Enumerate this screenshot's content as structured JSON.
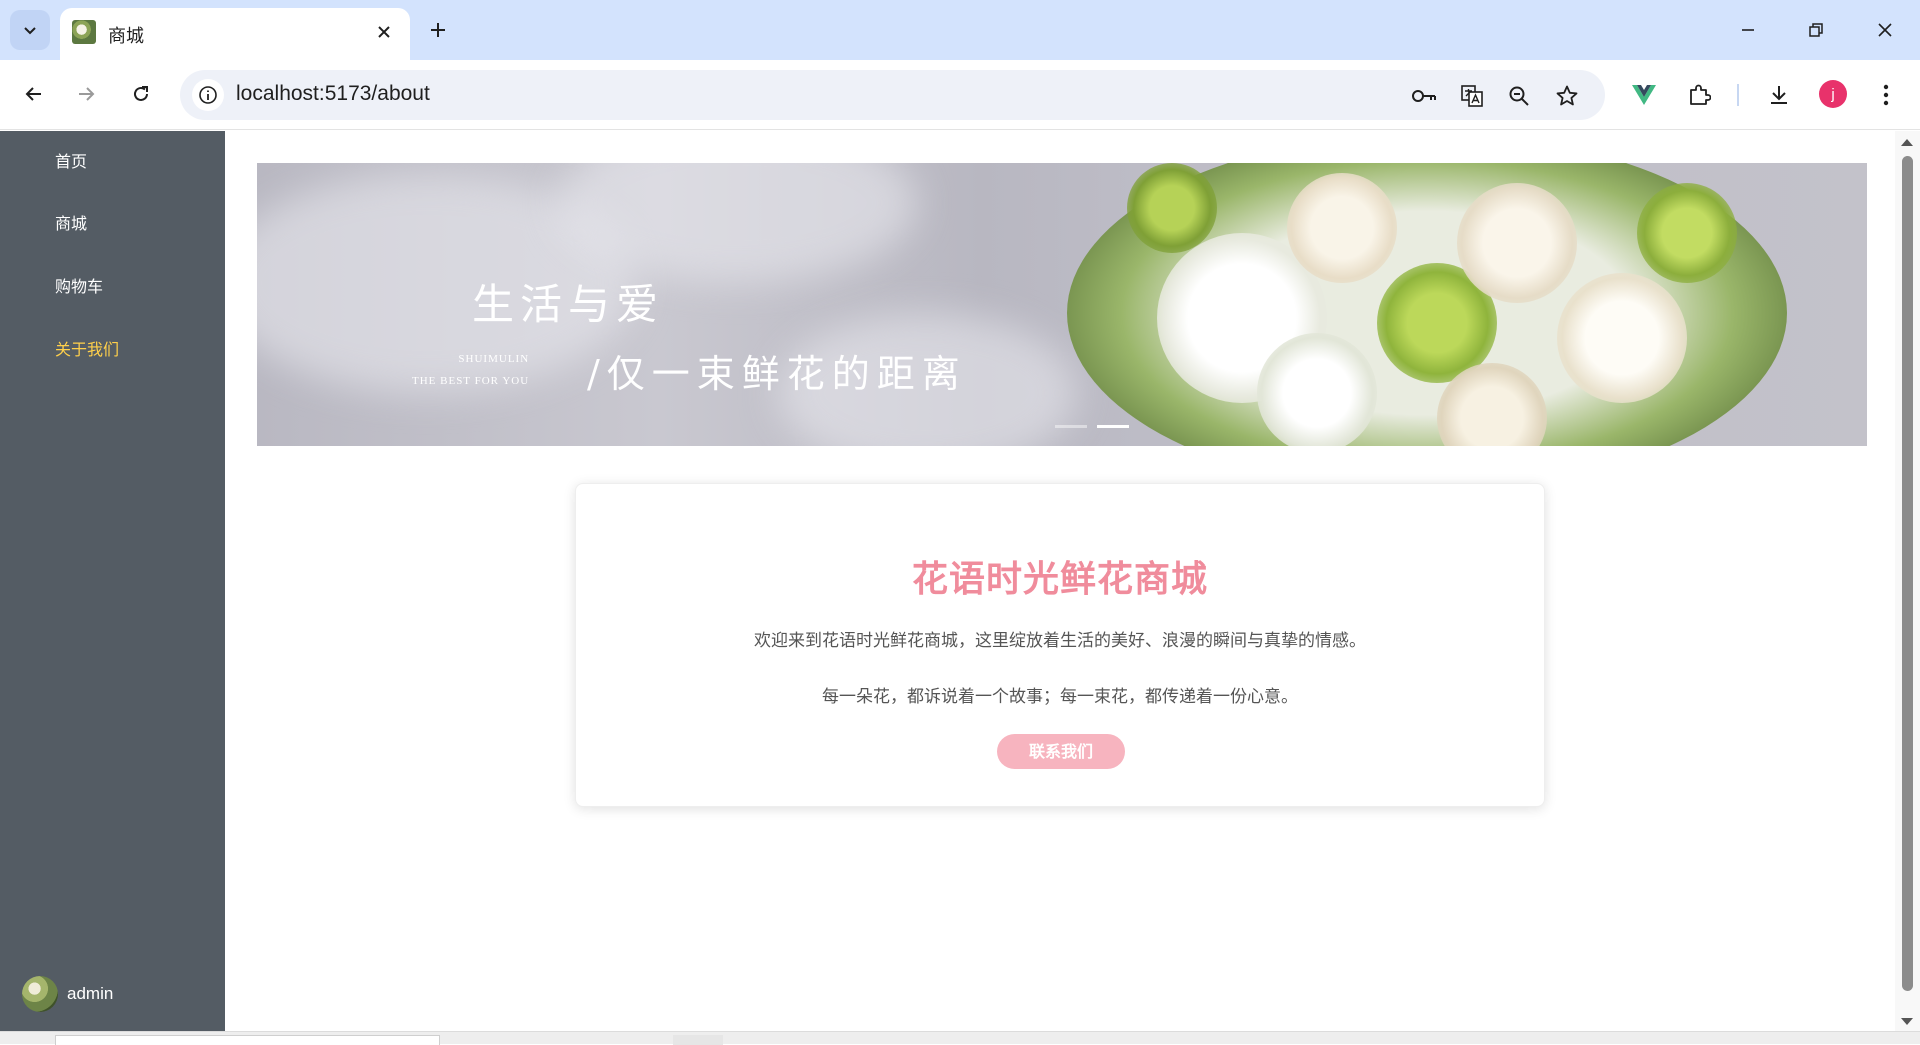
{
  "browser": {
    "tab_title": "商城",
    "url": "localhost:5173/about",
    "profile_initial": "j"
  },
  "sidebar": {
    "items": [
      {
        "label": "首页",
        "active": false
      },
      {
        "label": "商城",
        "active": false
      },
      {
        "label": "购物车",
        "active": false
      },
      {
        "label": "关于我们",
        "active": true
      }
    ],
    "user": {
      "name": "admin"
    },
    "active_color": "#ffd04b",
    "background": "#545c64"
  },
  "banner": {
    "title": "生活与爱",
    "small_line1": "SHUIMULIN",
    "small_line2": "THE BEST FOR YOU",
    "subtitle": "/仅一束鲜花的距离",
    "slide_count": 2,
    "active_slide": 2
  },
  "about": {
    "title": "花语时光鲜花商城",
    "paragraph1": "欢迎来到花语时光鲜花商城，这里绽放着生活的美好、浪漫的瞬间与真挚的情感。",
    "paragraph2": "每一朵花，都诉说着一个故事；每一束花，都传递着一份心意。",
    "button_label": "联系我们",
    "title_color": "#f08c9c",
    "button_color": "#f7b4bf"
  }
}
